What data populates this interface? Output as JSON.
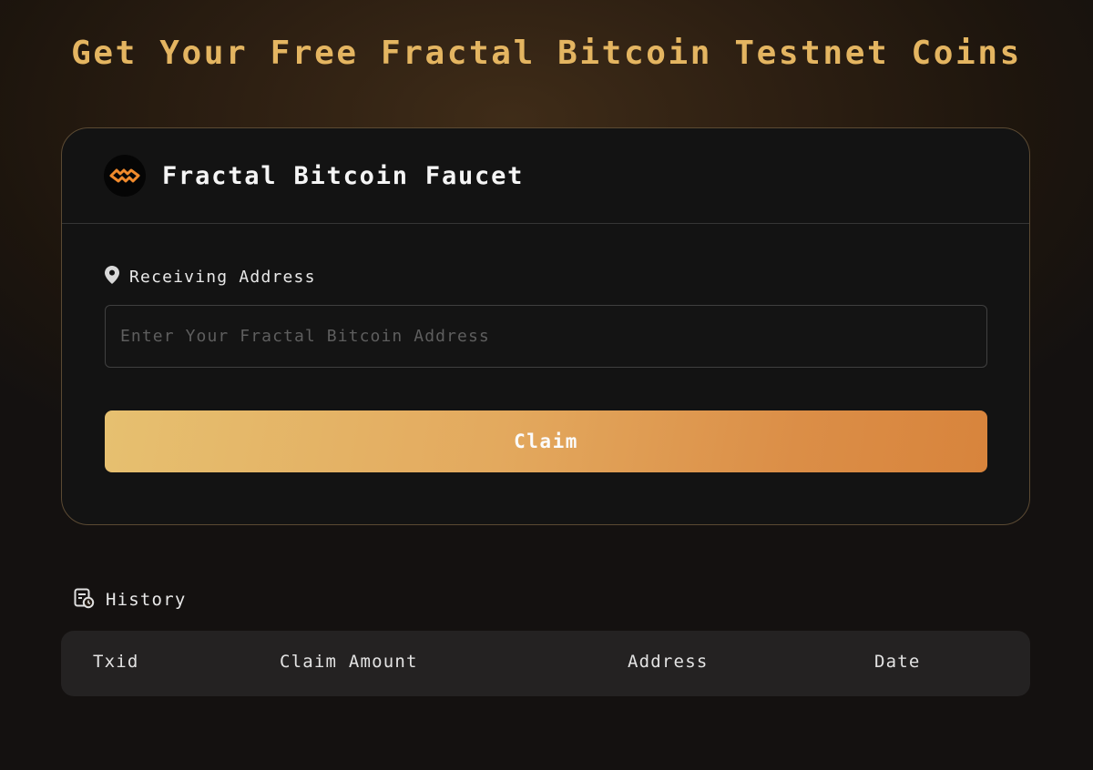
{
  "page": {
    "title": "Get Your Free Fractal Bitcoin Testnet Coins"
  },
  "faucet": {
    "logo_icon": "fractal-logo-icon",
    "title": "Fractal Bitcoin Faucet",
    "address_label": "Receiving Address",
    "address_label_icon": "location-pin-icon",
    "address_value": "",
    "address_placeholder": "Enter Your Fractal Bitcoin Address",
    "claim_label": "Claim"
  },
  "history": {
    "icon": "history-icon",
    "label": "History",
    "columns": [
      "Txid",
      "Claim Amount",
      "Address",
      "Date"
    ],
    "rows": []
  },
  "colors": {
    "accent": "#e4b561",
    "button_gradient_start": "#e6c070",
    "button_gradient_end": "#d8843c",
    "card_bg": "#131313",
    "card_border": "#5b4a33"
  }
}
